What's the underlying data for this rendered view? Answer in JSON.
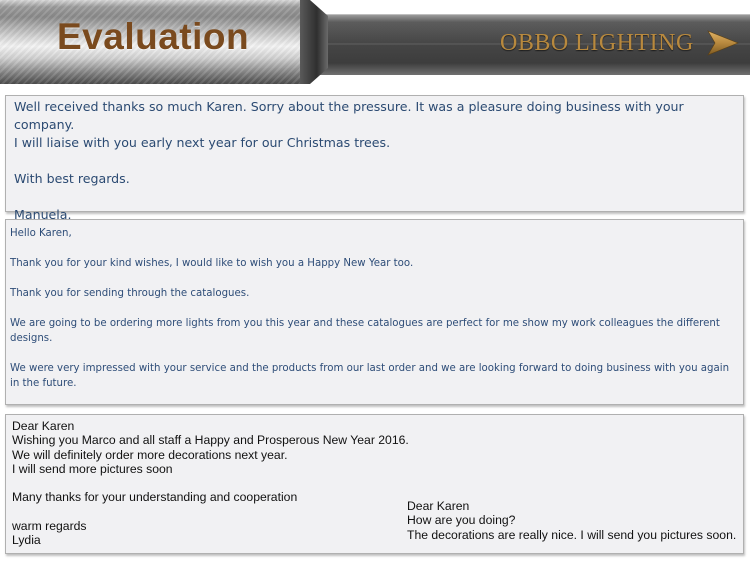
{
  "header": {
    "title": "Evaluation",
    "brand": "OBBO LIGHTING",
    "brand_icon": "arrow-right-icon",
    "colors": {
      "title": "#7a4a1e",
      "brand": "#b8893e"
    }
  },
  "messages": [
    {
      "paragraphs": [
        "Well received thanks so much Karen. Sorry about the pressure. It was a pleasure doing business with your company.",
        "I will liaise with you early next year for our Christmas trees.",
        "With best regards.",
        "Manuela."
      ]
    },
    {
      "paragraphs": [
        "Hello Karen,",
        "Thank you for your kind wishes, I would like to wish you a Happy New Year too.",
        "Thank you for sending through the catalogues.",
        "We are going to be ordering more lights from you this year and these catalogues are perfect for me show my work colleagues the different designs.",
        "We were very impressed with your service and the products from our last order and we are looking forward to doing business with you again in the future."
      ]
    },
    {
      "left_lines": [
        "Dear Karen",
        "Wishing you Marco and all staff a Happy and Prosperous New Year 2016.",
        "We will definitely order more decorations next year.",
        "I will send more pictures soon",
        "Many thanks for your understanding and cooperation",
        "warm regards",
        "Lydia"
      ],
      "right_lines": [
        "Dear Karen",
        "How are you doing?",
        "The decorations are really nice. I will send you pictures soon."
      ]
    }
  ]
}
